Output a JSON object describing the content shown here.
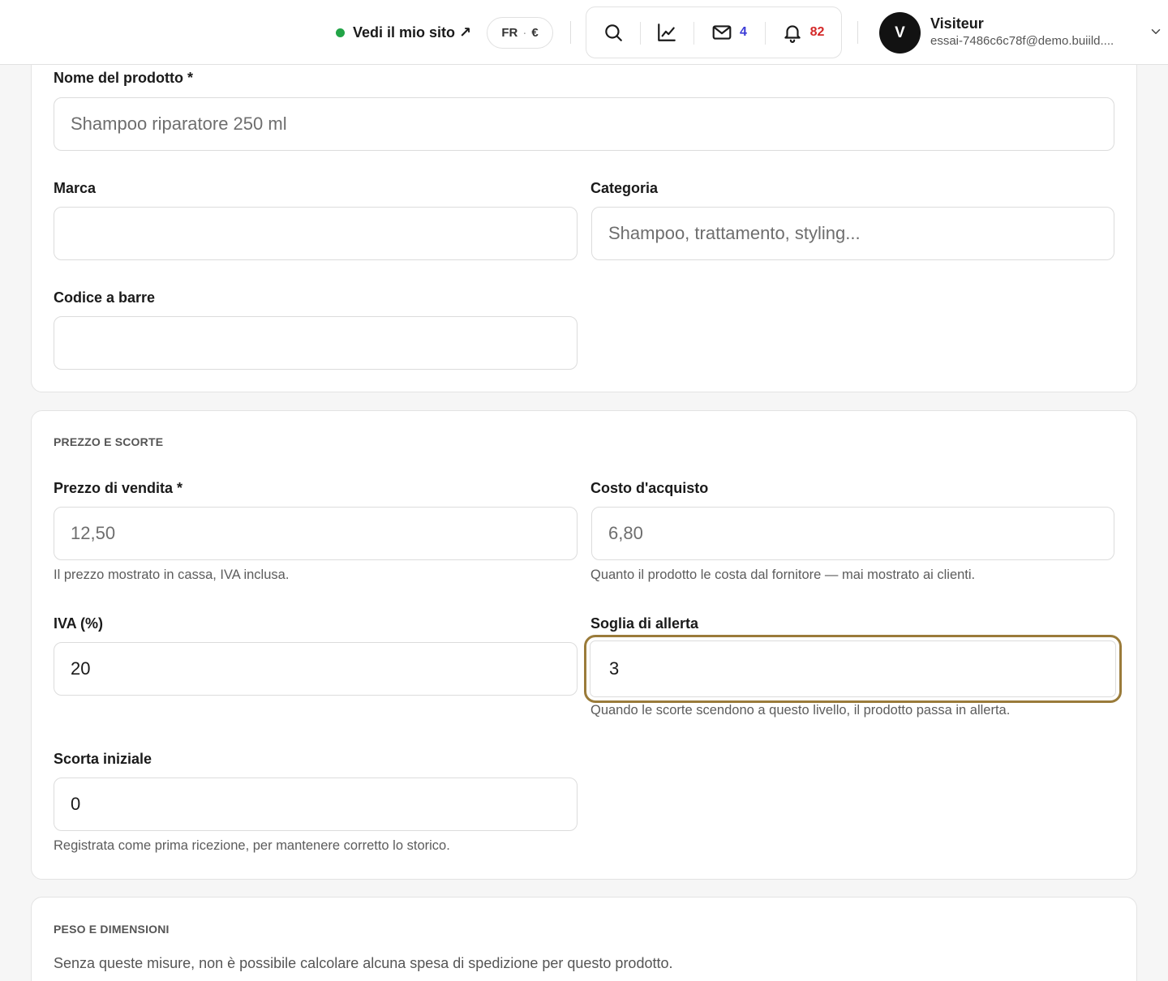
{
  "header": {
    "site_link_label": "Vedi il mio sito ↗",
    "locale": {
      "language": "FR",
      "separator": "·",
      "currency": "€"
    },
    "icons": {
      "search": "search-icon",
      "stats": "chart-line-icon",
      "mail": "mail-icon",
      "notifications": "bell-icon"
    },
    "mail_count": "4",
    "notification_count": "82",
    "user": {
      "initial": "V",
      "name": "Visiteur",
      "email": "essai-7486c6c78f@demo.buiild...."
    }
  },
  "product_card": {
    "name_label": "Nome del prodotto *",
    "name_placeholder": "Shampoo riparatore 250 ml",
    "brand_label": "Marca",
    "brand_value": "",
    "category_label": "Categoria",
    "category_placeholder": "Shampoo, trattamento, styling...",
    "barcode_label": "Codice a barre",
    "barcode_value": ""
  },
  "price_card": {
    "section_title": "PREZZO E SCORTE",
    "sale_price_label": "Prezzo di vendita *",
    "sale_price_placeholder": "12,50",
    "sale_price_help": "Il prezzo mostrato in cassa, IVA inclusa.",
    "cost_label": "Costo d'acquisto",
    "cost_placeholder": "6,80",
    "cost_help": "Quanto il prodotto le costa dal fornitore — mai mostrato ai clienti.",
    "vat_label": "IVA (%)",
    "vat_value": "20",
    "alert_label": "Soglia di allerta",
    "alert_value": "3",
    "alert_help": "Quando le scorte scendono a questo livello, il prodotto passa in allerta.",
    "initial_stock_label": "Scorta iniziale",
    "initial_stock_value": "0",
    "initial_stock_help": "Registrata come prima ricezione, per mantenere corretto lo storico."
  },
  "weight_card": {
    "section_title": "PESO E DIMENSIONI",
    "description": "Senza queste misure, non è possibile calcolare alcuna spesa di spedizione per questo prodotto."
  },
  "colors": {
    "accent_focus": "#9a7b3a",
    "status_online": "#22a447",
    "mail_badge": "#3b3bd6",
    "notification_badge": "#d42828"
  }
}
